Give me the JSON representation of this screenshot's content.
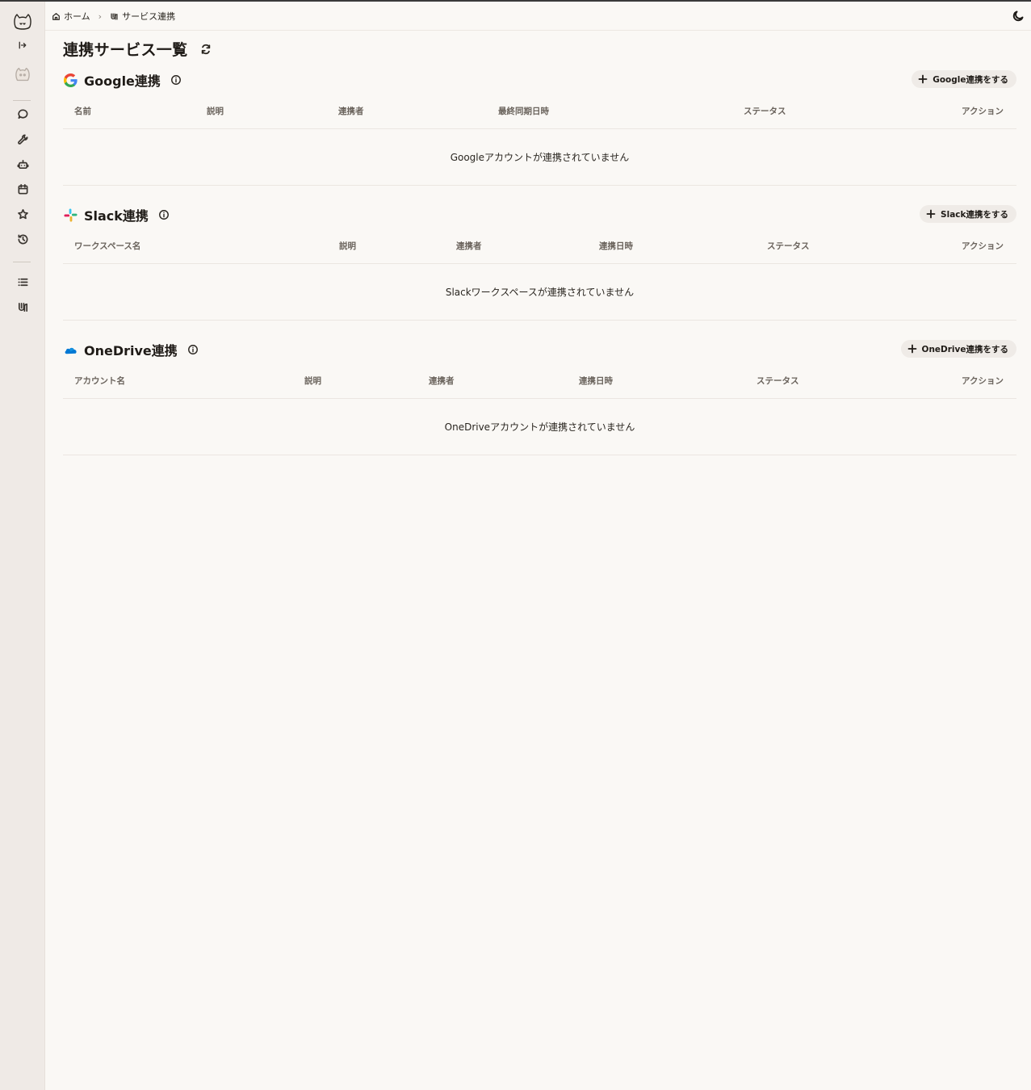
{
  "breadcrumb": {
    "home_label": "ホーム",
    "current_label": "サービス連携"
  },
  "page": {
    "title": "連携サービス一覧"
  },
  "sections": [
    {
      "id": "google",
      "title": "Google連携",
      "add_label": "Google連携をする",
      "columns": [
        "名前",
        "説明",
        "連携者",
        "最終同期日時",
        "ステータス",
        "アクション"
      ],
      "empty_message": "Googleアカウントが連携されていません"
    },
    {
      "id": "slack",
      "title": "Slack連携",
      "add_label": "Slack連携をする",
      "columns": [
        "ワークスペース名",
        "説明",
        "連携者",
        "連携日時",
        "ステータス",
        "アクション"
      ],
      "empty_message": "Slackワークスペースが連携されていません"
    },
    {
      "id": "onedrive",
      "title": "OneDrive連携",
      "add_label": "OneDrive連携をする",
      "columns": [
        "アカウント名",
        "説明",
        "連携者",
        "連携日時",
        "ステータス",
        "アクション"
      ],
      "empty_message": "OneDriveアカウントが連携されていません"
    }
  ],
  "sidebar": {
    "icons": [
      "app-logo-icon",
      "expand-sidebar-icon",
      "user-avatar",
      "chat-icon",
      "wrench-icon",
      "bot-icon",
      "calendar-icon",
      "star-icon",
      "history-icon",
      "list-icon",
      "integration-icon"
    ]
  },
  "colors": {
    "background": "#faf8f5",
    "sidebar": "#efeae6",
    "button_bg": "#efebe7",
    "google_blue": "#4285F4",
    "google_red": "#EA4335",
    "google_yellow": "#FBBC05",
    "google_green": "#34A853",
    "slack_teal": "#36C5F0",
    "slack_green": "#2EB67D",
    "slack_red": "#E01E5A",
    "slack_yellow": "#ECB22E",
    "onedrive_blue": "#0078D4"
  }
}
